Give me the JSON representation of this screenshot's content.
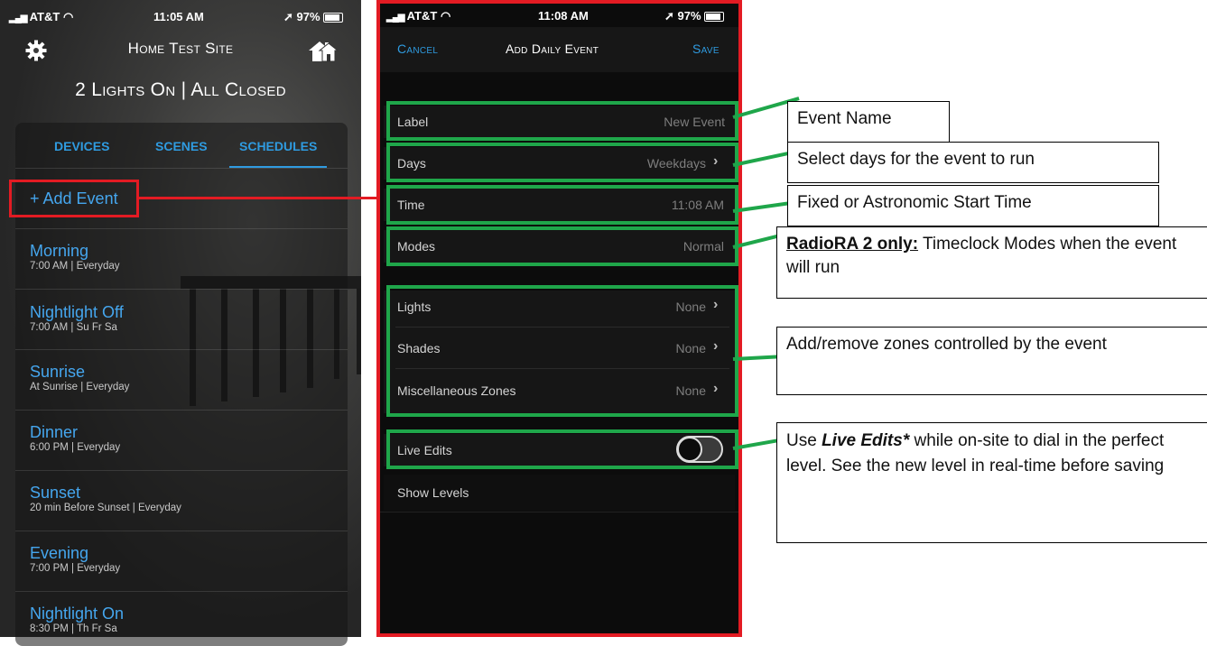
{
  "left_phone": {
    "status": {
      "carrier": "AT&T",
      "time": "11:05 AM",
      "battery": "97%"
    },
    "title": "Home Test Site",
    "summary": "2 Lights On | All Closed",
    "tabs": [
      "DEVICES",
      "SCENES",
      "SCHEDULES"
    ],
    "add_event_label": "+ Add Event",
    "events": [
      {
        "name": "Morning",
        "detail": "7:00 AM | Everyday"
      },
      {
        "name": "Nightlight Off",
        "detail": "7:00 AM | Su Fr Sa"
      },
      {
        "name": "Sunrise",
        "detail": "At Sunrise | Everyday"
      },
      {
        "name": "Dinner",
        "detail": "6:00 PM | Everyday"
      },
      {
        "name": "Sunset",
        "detail": "20 min Before Sunset | Everyday"
      },
      {
        "name": "Evening",
        "detail": "7:00 PM | Everyday"
      },
      {
        "name": "Nightlight On",
        "detail": "8:30 PM | Th Fr Sa"
      }
    ],
    "icons": [
      "gear-icon",
      "home-icon"
    ]
  },
  "right_phone": {
    "status": {
      "carrier": "AT&T",
      "time": "11:08 AM",
      "battery": "97%"
    },
    "nav": {
      "cancel": "Cancel",
      "title": "Add Daily Event",
      "save": "Save"
    },
    "rows": {
      "label": {
        "label": "Label",
        "value": "New Event"
      },
      "days": {
        "label": "Days",
        "value": "Weekdays"
      },
      "time": {
        "label": "Time",
        "value": "11:08 AM"
      },
      "modes": {
        "label": "Modes",
        "value": "Normal"
      },
      "lights": {
        "label": "Lights",
        "value": "None"
      },
      "shades": {
        "label": "Shades",
        "value": "None"
      },
      "misc": {
        "label": "Miscellaneous Zones",
        "value": "None"
      },
      "live_edits": {
        "label": "Live Edits",
        "toggle": "off"
      },
      "show_levels": {
        "label": "Show Levels"
      }
    }
  },
  "annotations": {
    "event_name": "Event Name",
    "days": "Select days for the event to run",
    "time": "Fixed or Astronomic Start Time",
    "modes_bold": "RadioRA 2 only:",
    "modes_rest": " Timeclock Modes when the event will run",
    "zones": "Add/remove zones controlled by the event",
    "live_prefix": "Use ",
    "live_em": "Live Edits*",
    "live_rest": " while on-site to dial in the perfect level. See the new level in real-time before saving"
  },
  "colors": {
    "accent_blue": "#2f9be0",
    "callout_red": "#e31b23",
    "callout_green": "#1fa64a"
  }
}
